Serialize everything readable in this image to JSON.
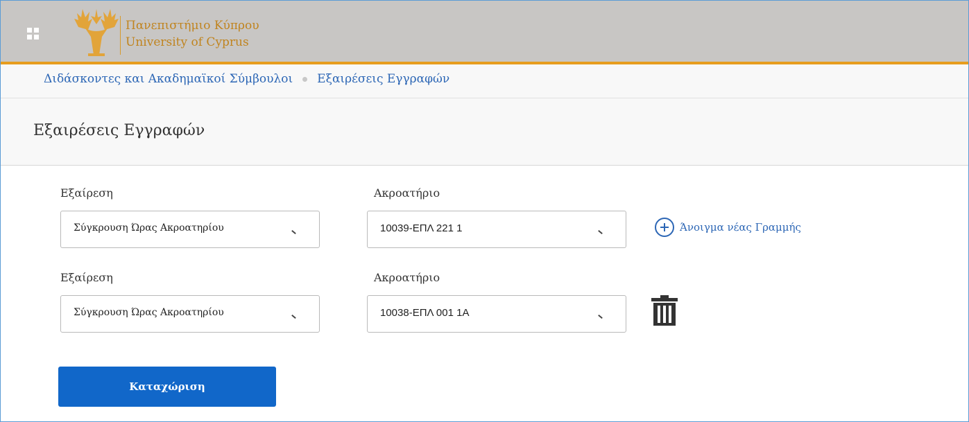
{
  "header": {
    "logo_line1": "Πανεπιστήμιο Κύπρου",
    "logo_line2": "University of Cyprus",
    "brand_color": "#e79d1e"
  },
  "breadcrumb": {
    "items": [
      "Διδάσκοντες και Ακαδημαϊκοί Σύμβουλοι",
      "Εξαιρέσεις Εγγραφών"
    ]
  },
  "page": {
    "title": "Εξαιρέσεις Εγγραφών"
  },
  "rows": [
    {
      "exception_label": "Εξαίρεση",
      "exception_value": "Σύγκρουση Ώρας Ακροατηρίου",
      "lecture_label": "Ακροατήριο",
      "lecture_value": "10039-ΕΠΛ 221 1"
    },
    {
      "exception_label": "Εξαίρεση",
      "exception_value": "Σύγκρουση Ώρας Ακροατηρίου",
      "lecture_label": "Ακροατήριο",
      "lecture_value": "10038-ΕΠΛ 001 1Α"
    }
  ],
  "actions": {
    "add_row_label": "Άνοιγμα νέας Γραμμής",
    "submit_label": "Καταχώριση",
    "accent_color": "#1167c9"
  },
  "icons": {
    "app_launcher": "app-launcher-icon",
    "add": "plus-circle-icon",
    "delete": "trash-icon",
    "dropdown": "chevron-down-icon"
  }
}
